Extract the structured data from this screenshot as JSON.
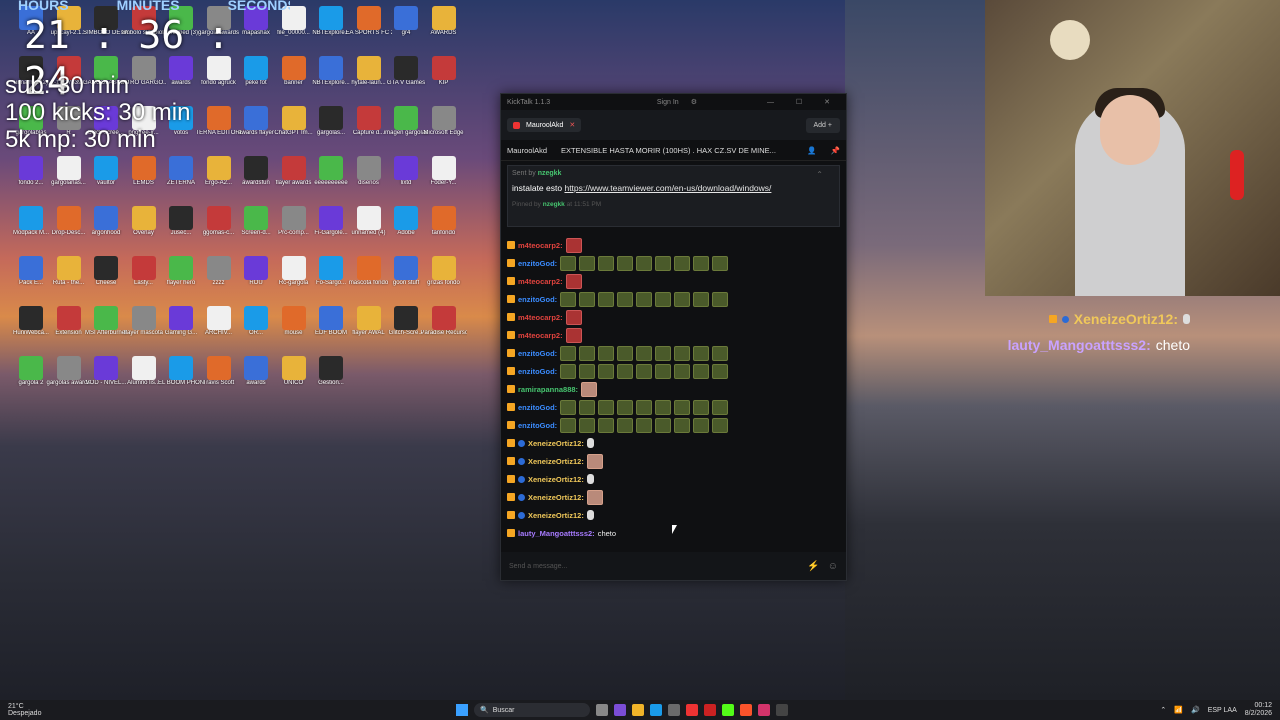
{
  "timer": {
    "headings": [
      "HOURS",
      "MINUTES",
      "SECONDS"
    ],
    "clock": "21 : 36 : 24"
  },
  "overlay": [
    "sub: 30 min",
    "100 kicks: 30 min",
    "5k mp: 30 min"
  ],
  "desktop_icons": [
    "AA",
    "upscayl-2.1...",
    "SIMBOLO DE SUB",
    "simbolo sub piola",
    "unnamed (3)",
    "gargola awards",
    "mapashax",
    "file_00000...",
    "NBTExplore...",
    "EA SPORTS FC 26",
    "gr4",
    "AWARDS",
    "unnamed (2)",
    "1-17-17339...",
    "GARGOLAS AWARDS",
    "INTRO GARGO...",
    "awards",
    "fondo agruck",
    "peke fot",
    "banner",
    "NBTExplore...",
    "hytale-laun...",
    "GTA V Games",
    "KIP",
    "gargolablas",
    "R",
    "black-scree...",
    "pngtree-ir...",
    "votos",
    "TERNA EDITORE...",
    "awards flayer",
    "ChatGPT Im...",
    "gargolas...",
    "Capture d...",
    "imagen gargolas",
    "Microsoft Edge",
    "fondo 2...",
    "gargolarlas...",
    "vaultor",
    "LEMDS",
    "ZETERNA",
    "Ergo-A2...",
    "awardsfun",
    "flayer awards",
    "eeeeeeeeee",
    "diseños",
    "lixtd",
    "Foder-Y...",
    "Modpack M...",
    "Drop-Desc...",
    "argonhood",
    "Overlay",
    "Jusec...",
    "ggomas-c...",
    "Screen-d...",
    "Prc-comp...",
    "Fi-Gargole...",
    "unnamed (4)",
    "Adobe",
    "tanfondo",
    "Pack E...",
    "Ruta - the...",
    "Cheese",
    "Lasty...",
    "flayer hero",
    "zzzz",
    "ROU",
    "Rc-gargola",
    "Fo-Sargo...",
    "mascota fondo",
    "goon stuff",
    "grizas fondo",
    "HuniWebca...",
    "Extension",
    "MSI Afterburner",
    "flayer mascota",
    "Gaming G...",
    "ARCHIV...",
    "OR...",
    "mouse",
    "EDF BOOM",
    "flayer AWAL",
    "Glitch-Scre...",
    "Paradise Recursos...",
    "gargola 2",
    "gargolas awards",
    "VOD - NIVEL...",
    "Alumno lis...",
    "EL BOOM PHONK",
    "Travis Scott",
    "awards",
    "UNICO",
    "Gestion..."
  ],
  "kicktalk": {
    "title": "KickTalk 1.1.3",
    "signin": "Sign In",
    "window_buttons": "— ☐ ✕",
    "tab": "MauroolAkd",
    "add_label": "Add +",
    "channel": "MauroolAkd",
    "stream_title": "EXTENSIBLE HASTA MORIR (100HS) . HAX CZ.SV DE MINE...",
    "pinned": {
      "sent_by_prefix": "Sent by",
      "sent_by_user": "nzegkk",
      "message_prefix": "instalate esto",
      "link": "https://www.teamviewer.com/en-us/download/windows/",
      "pinned_by_prefix": "Pinned by",
      "pinned_by_user": "nzegkk",
      "pinned_time": "at 11:51 PM"
    },
    "messages": [
      {
        "user": "m4teocarp2:",
        "color": "#e0433e",
        "emotes": "red1"
      },
      {
        "user": "enzitoGod:",
        "color": "#3b8cff",
        "emotes": "green9"
      },
      {
        "user": "m4teocarp2:",
        "color": "#e0433e",
        "emotes": "red1"
      },
      {
        "user": "enzitoGod:",
        "color": "#3b8cff",
        "emotes": "green9"
      },
      {
        "user": "m4teocarp2:",
        "color": "#e0433e",
        "emotes": "red1"
      },
      {
        "user": "m4teocarp2:",
        "color": "#e0433e",
        "emotes": "red1"
      },
      {
        "user": "enzitoGod:",
        "color": "#3b8cff",
        "emotes": "green9"
      },
      {
        "user": "enzitoGod:",
        "color": "#3b8cff",
        "emotes": "green9"
      },
      {
        "user": "ramirapanna888:",
        "color": "#46c46f",
        "emotes": "face1"
      },
      {
        "user": "enzitoGod:",
        "color": "#3b8cff",
        "emotes": "green9"
      },
      {
        "user": "enzitoGod:",
        "color": "#3b8cff",
        "emotes": "green9"
      },
      {
        "user": "XeneizeOrtiz12:",
        "color": "#f0c85a",
        "emotes": "small"
      },
      {
        "user": "XeneizeOrtiz12:",
        "color": "#f0c85a",
        "emotes": "face1"
      },
      {
        "user": "XeneizeOrtiz12:",
        "color": "#f0c85a",
        "emotes": "small"
      },
      {
        "user": "XeneizeOrtiz12:",
        "color": "#f0c85a",
        "emotes": "face1"
      },
      {
        "user": "XeneizeOrtiz12:",
        "color": "#f0c85a",
        "emotes": "small"
      },
      {
        "user": "lauty_Mangoatttsss2:",
        "color": "#a77bff",
        "text": "cheto"
      }
    ],
    "send_placeholder": "Send a message..."
  },
  "webcam_chat": [
    {
      "user": "XeneizeOrtiz12:",
      "text": ""
    },
    {
      "user": "lauty_Mangoatttsss2:",
      "text": "cheto"
    }
  ],
  "taskbar": {
    "weather_temp": "21°C",
    "weather_desc": "Despejado",
    "search_label": "Buscar",
    "lang": "ESP LAA",
    "time": "00:12",
    "date": "8/2/2026"
  }
}
